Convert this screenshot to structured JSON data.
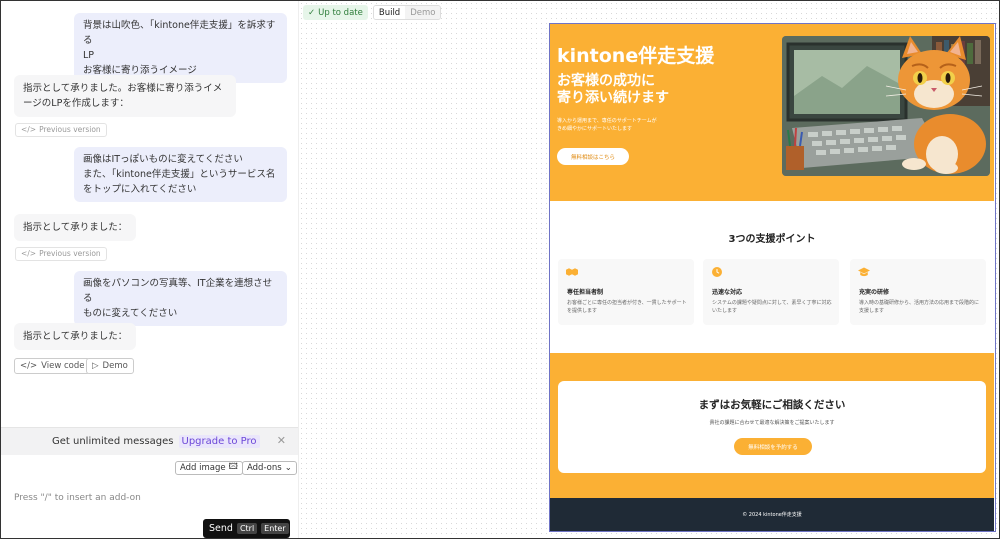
{
  "chat": {
    "messages": [
      {
        "role": "user",
        "lines": [
          "背景は山吹色、「kintone伴走支援」を訴求する",
          "LP",
          "お客様に寄り添うイメージ"
        ]
      },
      {
        "role": "ai",
        "lines": [
          "指示として承りました。お客様に寄り添うイメ",
          "ージのLPを作成します："
        ]
      },
      {
        "role": "user",
        "lines": [
          "画像はITっぽいものに変えてください",
          "また、「kintone伴走支援」というサービス名",
          "をトップに入れてください"
        ]
      },
      {
        "role": "ai",
        "lines": [
          "指示として承りました："
        ]
      },
      {
        "role": "user",
        "lines": [
          "画像をパソコンの写真等、IT企業を連想させる",
          "ものに変えてください"
        ]
      },
      {
        "role": "ai",
        "lines": [
          "指示として承りました："
        ]
      }
    ],
    "previous_version_label": "Previous version",
    "view_code_label": "View code",
    "demo_label": "Demo"
  },
  "composer": {
    "upgrade_text": "Get unlimited messages",
    "upgrade_link": "Upgrade to Pro",
    "add_image_label": "Add image",
    "addons_label": "Add-ons",
    "placeholder": "Press \"/\" to insert an add-on",
    "send_label": "Send",
    "kbd_ctrl": "Ctrl",
    "kbd_enter": "Enter"
  },
  "toolbar": {
    "status": "Up to date",
    "build": "Build",
    "demo": "Demo"
  },
  "preview": {
    "hero_title": "kintone伴走支援",
    "hero_sub_1": "お客様の成功に",
    "hero_sub_2": "寄り添い続けます",
    "hero_desc_1": "導入から運用まで、専任のサポートチームが",
    "hero_desc_2": "きめ細やかにサポートいたします",
    "hero_btn": "無料相談はこちら",
    "features_title": "3つの支援ポイント",
    "cards": [
      {
        "title": "専任担当者制",
        "desc": "お客様ごとに専任の担当者が付き、一貫したサポートを提供します"
      },
      {
        "title": "迅速な対応",
        "desc": "システムの課題や疑問点に対して、素早く丁寧に対応いたします"
      },
      {
        "title": "充実の研修",
        "desc": "導入時の基礎研修から、活用方法の応用まで段階的に支援します"
      }
    ],
    "cta_title": "まずはお気軽にご相談ください",
    "cta_desc": "貴社の課題に合わせて最適な解決策をご提案いたします",
    "cta_btn": "無料相談を予約する",
    "footer": "© 2024 kintone伴走支援"
  },
  "colors": {
    "accent": "#fbb034",
    "footer": "#1f2a36",
    "upgrade": "#6c47d8"
  }
}
